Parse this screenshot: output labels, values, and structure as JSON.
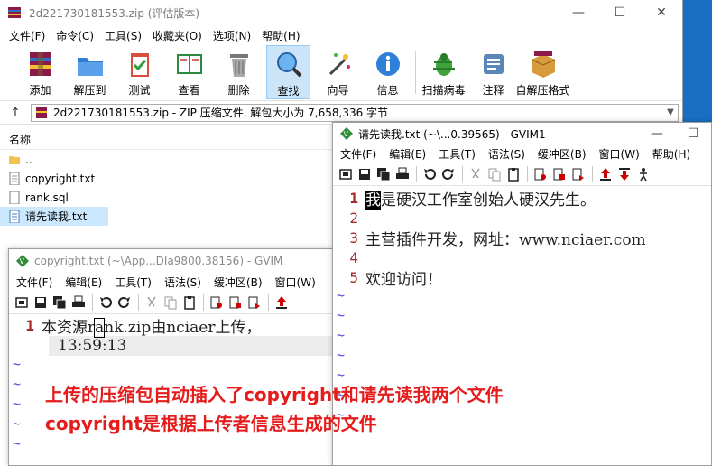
{
  "rar": {
    "title": "2d221730181553.zip (评估版本)",
    "menu": [
      "文件(F)",
      "命令(C)",
      "工具(S)",
      "收藏夹(O)",
      "选项(N)",
      "帮助(H)"
    ],
    "toolbar": [
      "添加",
      "解压到",
      "测试",
      "查看",
      "删除",
      "查找",
      "向导",
      "信息",
      "扫描病毒",
      "注释",
      "自解压格式"
    ],
    "address": "2d221730181553.zip - ZIP 压缩文件, 解包大小为 7,658,336 字节",
    "list_header": "名称",
    "files": [
      "..",
      "copyright.txt",
      "rank.sql",
      "请先读我.txt"
    ]
  },
  "gvim1": {
    "title": "请先读我.txt (~\\...0.39565) - GVIM1",
    "menu": [
      "文件(F)",
      "编辑(E)",
      "工具(T)",
      "语法(S)",
      "缓冲区(B)",
      "窗口(W)",
      "帮助(H)"
    ],
    "lines": [
      {
        "num": "1",
        "cursor_char": "我",
        "text": "是硬汉工作室创始人硬汉先生。"
      },
      {
        "num": "2",
        "text": ""
      },
      {
        "num": "3",
        "text": "主营插件开发，网址：www.nciaer.com"
      },
      {
        "num": "4",
        "text": ""
      },
      {
        "num": "5",
        "text": "欢迎访问！"
      }
    ]
  },
  "gvim2": {
    "title": "copyright.txt (~\\App...DIa9800.38156) - GVIM",
    "menu": [
      "文件(F)",
      "编辑(E)",
      "工具(T)",
      "语法(S)",
      "缓冲区(B)",
      "窗口(W)"
    ],
    "line1_num": "1",
    "line1_a": "本资源r",
    "line1_cursor": "a",
    "line1_b": "nk.zip由nciaer上传，",
    "line1_cont": "13:59:13"
  },
  "annotation": {
    "line1": "上传的压缩包自动插入了copyright和请先读我两个文件",
    "line2": "copyright是根据上传者信息生成的文件"
  },
  "colors": {
    "annotation": "#e51c1c",
    "line_number": "#a52a2a",
    "tilde": "#4a4ae0",
    "selection": "#cce8ff"
  }
}
